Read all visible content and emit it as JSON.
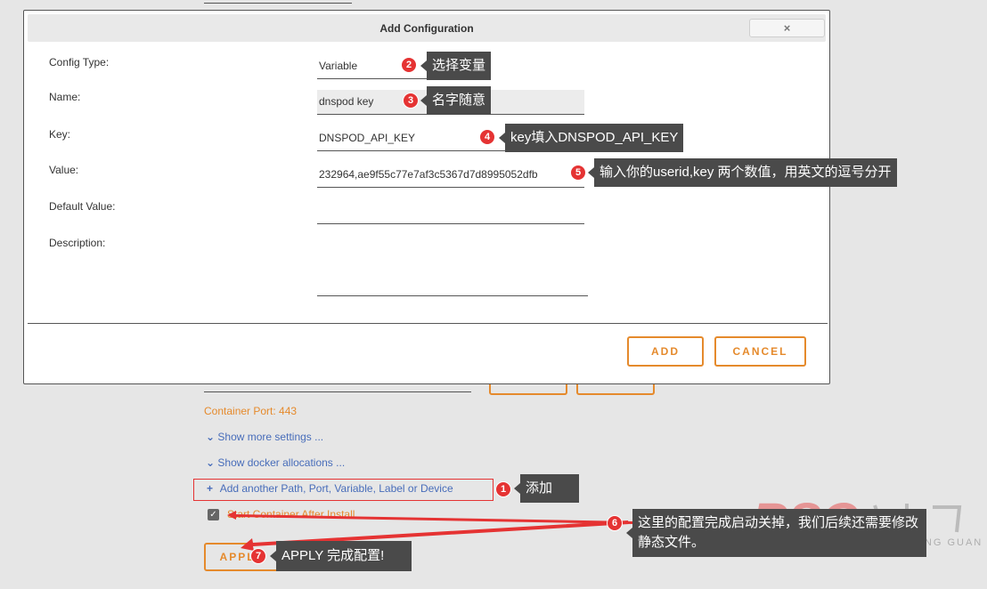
{
  "modal": {
    "title": "Add Configuration",
    "close_icon": "×",
    "fields": [
      {
        "label": "Config Type:",
        "value": "Variable"
      },
      {
        "label": "Name:",
        "value": "dnspod key"
      },
      {
        "label": "Key:",
        "value": "DNSPOD_API_KEY"
      },
      {
        "label": "Value:",
        "value": "232964,ae9f55c77e7af3c5367d7d8995052dfb"
      },
      {
        "label": "Default Value:",
        "value": ""
      },
      {
        "label": "Description:",
        "value": ""
      }
    ],
    "add_label": "ADD",
    "cancel_label": "CANCEL"
  },
  "background": {
    "container_port": "Container Port: 443",
    "show_more": "Show more settings ...",
    "show_docker": "Show docker allocations ...",
    "add_another": "Add another Path, Port, Variable, Label or Device",
    "start_container": "Start Container After Install",
    "apply_label": "APPLY"
  },
  "annotations": {
    "a1": {
      "num": "1",
      "text": "添加"
    },
    "a2": {
      "num": "2",
      "text": "选择变量"
    },
    "a3": {
      "num": "3",
      "text": "名字随意"
    },
    "a4": {
      "num": "4",
      "text": "key填入DNSPOD_API_KEY"
    },
    "a5": {
      "num": "5",
      "text": "输入你的userid,key 两个数值，用英文的逗号分开"
    },
    "a6": {
      "num": "6",
      "text": "这里的配置完成启动关掉，我们后续还需要修改静态文件。"
    },
    "a7": {
      "num": "7",
      "text": "APPLY 完成配置!"
    }
  },
  "watermark": {
    "text": "REN SHENG GUAN"
  },
  "colors": {
    "accent": "#e58a2c",
    "link": "#486dba",
    "badge": "#e53333",
    "tip": "#4a4a4a"
  }
}
